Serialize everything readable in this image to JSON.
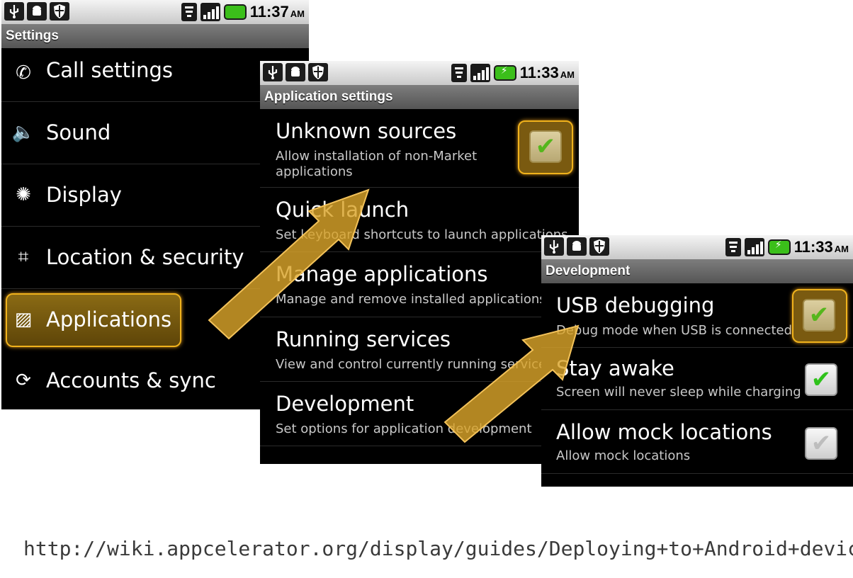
{
  "screen1": {
    "status": {
      "time": "11:37",
      "ampm": "AM"
    },
    "title": "Settings",
    "items": [
      {
        "label": "Call settings",
        "icon": "phone-icon"
      },
      {
        "label": "Sound",
        "icon": "speaker-icon"
      },
      {
        "label": "Display",
        "icon": "brightness-icon"
      },
      {
        "label": "Location & security",
        "icon": "location-grid-icon"
      },
      {
        "label": "Applications",
        "icon": "applications-icon",
        "selected": true
      },
      {
        "label": "Accounts & sync",
        "icon": "sync-icon"
      }
    ]
  },
  "screen2": {
    "status": {
      "time": "11:33",
      "ampm": "AM"
    },
    "title": "Application settings",
    "items": [
      {
        "label": "Unknown sources",
        "sub": "Allow installation of non-Market applications",
        "checked": true
      },
      {
        "label": "Quick launch",
        "sub": "Set keyboard shortcuts to launch applications"
      },
      {
        "label": "Manage applications",
        "sub": "Manage and remove installed applications"
      },
      {
        "label": "Running services",
        "sub": "View and control currently running services"
      },
      {
        "label": "Development",
        "sub": "Set options for application development"
      }
    ]
  },
  "screen3": {
    "status": {
      "time": "11:33",
      "ampm": "AM"
    },
    "title": "Development",
    "items": [
      {
        "label": "USB debugging",
        "sub": "Debug mode when USB is connected",
        "checked": true
      },
      {
        "label": "Stay awake",
        "sub": "Screen will never sleep while charging",
        "checked": true
      },
      {
        "label": "Allow mock locations",
        "sub": "Allow mock locations",
        "checked": true
      }
    ]
  },
  "caption": {
    "url": "http://wiki.appcelerator.org/display/guides/Deploying+to+Android+devices"
  },
  "colors": {
    "highlight": "#f0b21c",
    "arrow": "#e8b53a",
    "check_green": "#2fc21b"
  }
}
